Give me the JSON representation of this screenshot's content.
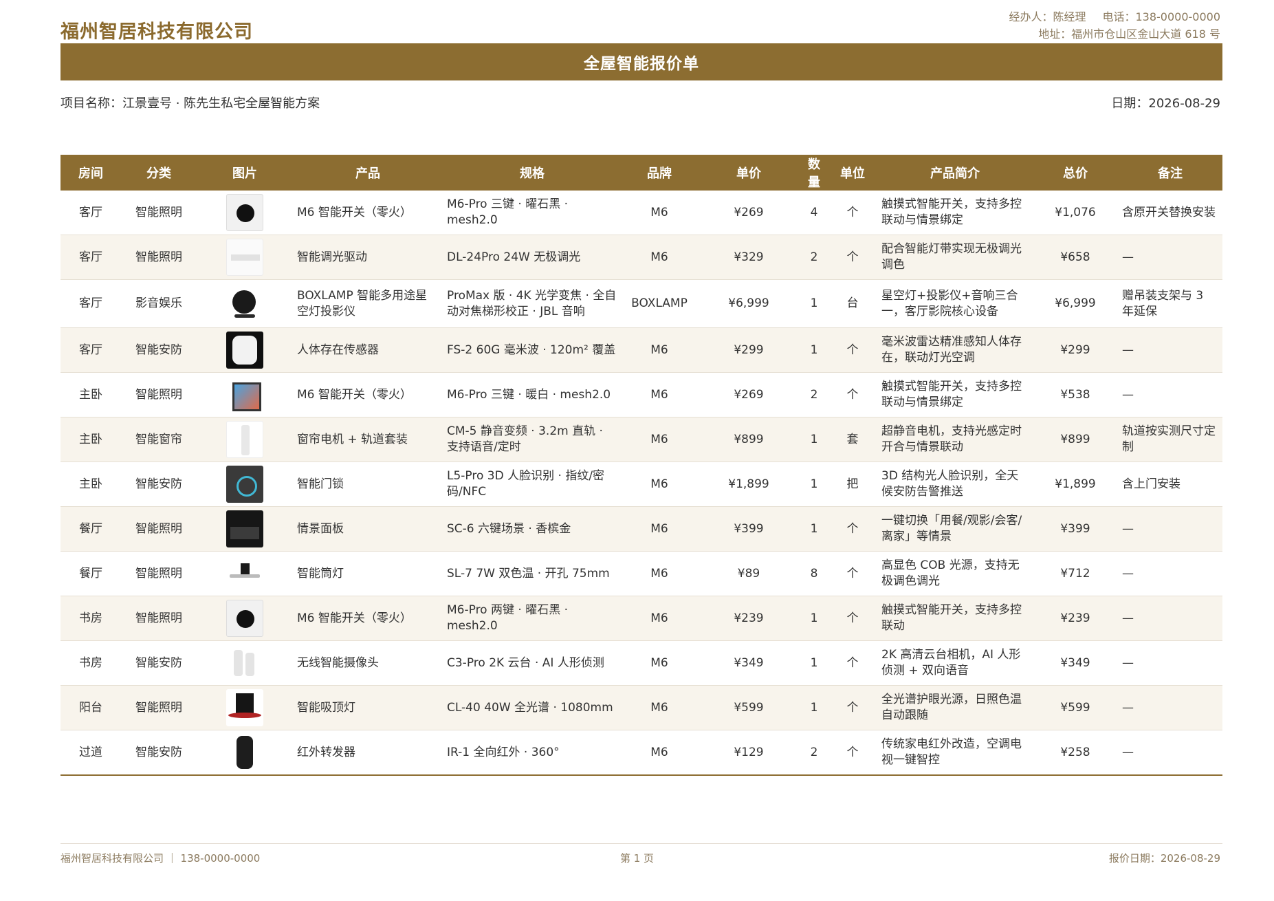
{
  "header": {
    "company": "福州智居科技有限公司",
    "manager": "经办人：陈经理",
    "phone": "电话：138-0000-0000",
    "address": "地址：福州市仓山区金山大道 618 号",
    "title": "全屋智能报价单",
    "project": "项目名称：江景壹号 · 陈先生私宅全屋智能方案",
    "date": "日期：2026-08-29"
  },
  "table": {
    "columns": [
      "房间",
      "分类",
      "图片",
      "产品",
      "规格",
      "品牌",
      "单价",
      "数量",
      "单位",
      "产品简介",
      "总价",
      "备注"
    ],
    "rows": [
      {
        "room": "客厅",
        "category": "智能照明",
        "image": "smart-switch-black",
        "product": "M6 智能开关（零火）",
        "spec": "M6-Pro 三键 · 曜石黑 · mesh2.0",
        "brand": "M6",
        "unit_price": "¥269",
        "qty": "4",
        "unit": "个",
        "intro": "触摸式智能开关，支持多控联动与情景绑定",
        "total": "¥1,076",
        "note": "含原开关替换安装"
      },
      {
        "room": "客厅",
        "category": "智能照明",
        "image": "dimmer-driver",
        "product": "智能调光驱动",
        "spec": "DL-24Pro 24W 无极调光",
        "brand": "M6",
        "unit_price": "¥329",
        "qty": "2",
        "unit": "个",
        "intro": "配合智能灯带实现无极调光调色",
        "total": "¥658",
        "note": "—"
      },
      {
        "room": "客厅",
        "category": "影音娱乐",
        "image": "star-projector",
        "product": "BOXLAMP 智能多用途星空灯投影仪",
        "spec": "ProMax 版 · 4K 光学变焦 · 全自动对焦梯形校正 · JBL 音响",
        "brand": "BOXLAMP",
        "unit_price": "¥6,999",
        "qty": "1",
        "unit": "台",
        "intro": "星空灯+投影仪+音响三合一，客厅影院核心设备",
        "total": "¥6,999",
        "note": "赠吊装支架与 3 年延保"
      },
      {
        "room": "客厅",
        "category": "智能安防",
        "image": "presence-sensor",
        "product": "人体存在传感器",
        "spec": "FS-2 60G 毫米波 · 120m² 覆盖",
        "brand": "M6",
        "unit_price": "¥299",
        "qty": "1",
        "unit": "个",
        "intro": "毫米波雷达精准感知人体存在，联动灯光空调",
        "total": "¥299",
        "note": "—"
      },
      {
        "room": "主卧",
        "category": "智能照明",
        "image": "smart-switch-panel",
        "product": "M6 智能开关（零火）",
        "spec": "M6-Pro 三键 · 暖白 · mesh2.0",
        "brand": "M6",
        "unit_price": "¥269",
        "qty": "2",
        "unit": "个",
        "intro": "触摸式智能开关，支持多控联动与情景绑定",
        "total": "¥538",
        "note": "—"
      },
      {
        "room": "主卧",
        "category": "智能窗帘",
        "image": "curtain-motor",
        "product": "窗帘电机 + 轨道套装",
        "spec": "CM-5 静音变频 · 3.2m 直轨 · 支持语音/定时",
        "brand": "M6",
        "unit_price": "¥899",
        "qty": "1",
        "unit": "套",
        "intro": "超静音电机，支持光感定时开合与情景联动",
        "total": "¥899",
        "note": "轨道按实测尺寸定制"
      },
      {
        "room": "主卧",
        "category": "智能安防",
        "image": "smart-lock",
        "product": "智能门锁",
        "spec": "L5-Pro 3D 人脸识别 · 指纹/密码/NFC",
        "brand": "M6",
        "unit_price": "¥1,899",
        "qty": "1",
        "unit": "把",
        "intro": "3D 结构光人脸识别，全天候安防告警推送",
        "total": "¥1,899",
        "note": "含上门安装"
      },
      {
        "room": "餐厅",
        "category": "智能照明",
        "image": "scene-panel",
        "product": "情景面板",
        "spec": "SC-6 六键场景 · 香槟金",
        "brand": "M6",
        "unit_price": "¥399",
        "qty": "1",
        "unit": "个",
        "intro": "一键切换「用餐/观影/会客/离家」等情景",
        "total": "¥399",
        "note": "—"
      },
      {
        "room": "餐厅",
        "category": "智能照明",
        "image": "downlight",
        "product": "智能筒灯",
        "spec": "SL-7 7W 双色温 · 开孔 75mm",
        "brand": "M6",
        "unit_price": "¥89",
        "qty": "8",
        "unit": "个",
        "intro": "高显色 COB 光源，支持无极调色调光",
        "total": "¥712",
        "note": "—"
      },
      {
        "room": "书房",
        "category": "智能照明",
        "image": "smart-switch-black",
        "product": "M6 智能开关（零火）",
        "spec": "M6-Pro 两键 · 曜石黑 · mesh2.0",
        "brand": "M6",
        "unit_price": "¥239",
        "qty": "1",
        "unit": "个",
        "intro": "触摸式智能开关，支持多控联动",
        "total": "¥239",
        "note": "—"
      },
      {
        "room": "书房",
        "category": "智能安防",
        "image": "wireless-camera",
        "product": "无线智能摄像头",
        "spec": "C3-Pro 2K 云台 · AI 人形侦测",
        "brand": "M6",
        "unit_price": "¥349",
        "qty": "1",
        "unit": "个",
        "intro": "2K 高清云台相机，AI 人形侦测 + 双向语音",
        "total": "¥349",
        "note": "—"
      },
      {
        "room": "阳台",
        "category": "智能照明",
        "image": "ceiling-light",
        "product": "智能吸顶灯",
        "spec": "CL-40 40W 全光谱 · 1080mm",
        "brand": "M6",
        "unit_price": "¥599",
        "qty": "1",
        "unit": "个",
        "intro": "全光谱护眼光源，日照色温自动跟随",
        "total": "¥599",
        "note": "—"
      },
      {
        "room": "过道",
        "category": "智能安防",
        "image": "ir-blaster",
        "product": "红外转发器",
        "spec": "IR-1 全向红外 · 360°",
        "brand": "M6",
        "unit_price": "¥129",
        "qty": "2",
        "unit": "个",
        "intro": "传统家电红外改造，空调电视一键智控",
        "total": "¥258",
        "note": "—"
      }
    ]
  },
  "footer": {
    "left": "福州智居科技有限公司 ｜ 138-0000-0000",
    "page": "第 1 页",
    "right": "报价日期：2026-08-29"
  },
  "colors": {
    "accent": "#8c6d31",
    "row_alt": "#f8f4ec",
    "muted_text": "#8b7a5e"
  }
}
